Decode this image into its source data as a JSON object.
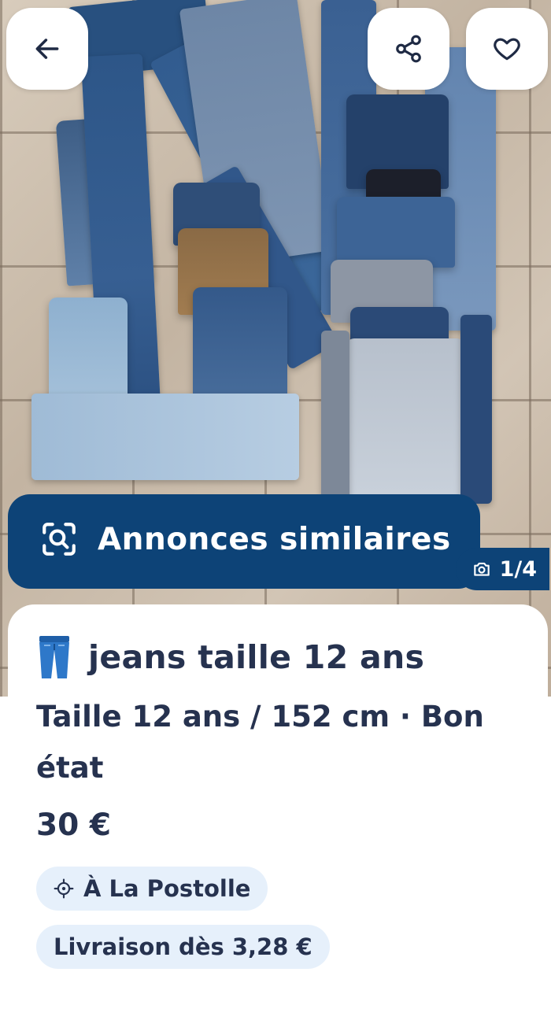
{
  "photo": {
    "counter": "1/4",
    "similar_label": "Annonces similaires"
  },
  "icons": {
    "back": "arrow-left-icon",
    "share": "share-icon",
    "favorite": "heart-icon",
    "similar": "visual-search-icon",
    "camera": "camera-icon",
    "location": "crosshair-icon",
    "title_emoji": "jeans-emoji"
  },
  "listing": {
    "title": "jeans taille 12 ans",
    "subtitle": "Taille 12 ans / 152 cm · Bon état",
    "price": "30 €",
    "location": "À La Postolle",
    "shipping": "Livraison dès 3,28 €"
  },
  "colors": {
    "primary": "#0d4377",
    "chip_bg": "#e6f0fb",
    "text": "#26324f"
  }
}
